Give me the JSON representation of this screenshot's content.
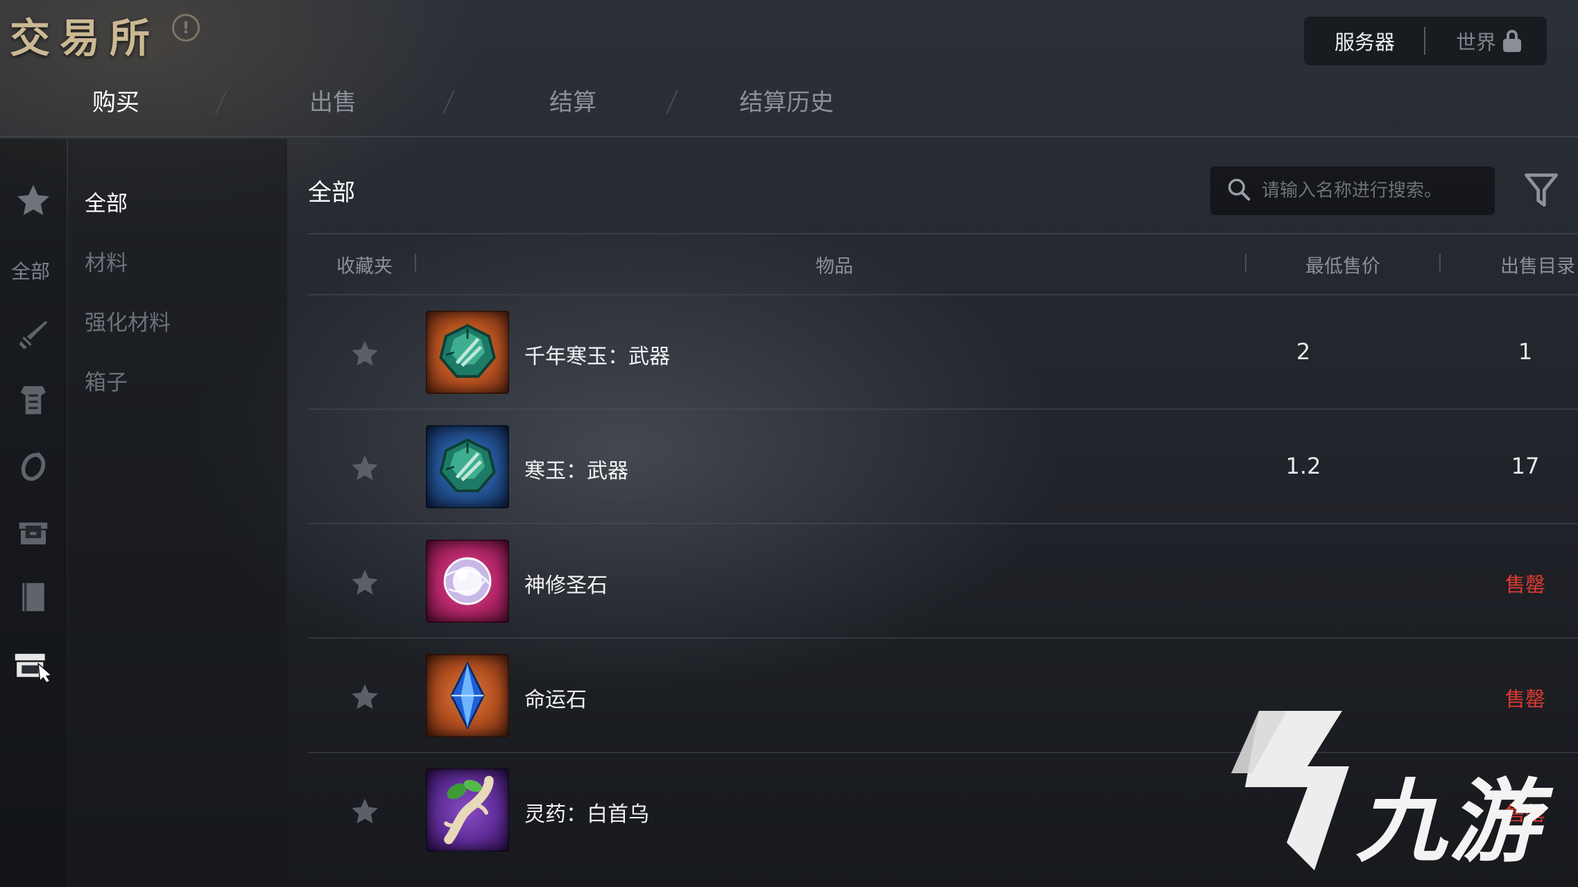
{
  "header": {
    "title": "交易所",
    "server_options": [
      {
        "label": "服务器",
        "active": true
      },
      {
        "label": "世界",
        "active": false,
        "locked": true
      }
    ],
    "tabs": [
      {
        "label": "购买",
        "active": true
      },
      {
        "label": "出售",
        "active": false
      },
      {
        "label": "结算",
        "active": false
      },
      {
        "label": "结算历史",
        "active": false
      }
    ]
  },
  "rail": {
    "items": [
      "star-icon",
      "all",
      "sword-icon",
      "armor-icon",
      "ring-icon",
      "chest-icon",
      "book-icon",
      "trade-icon"
    ],
    "all_label": "全部"
  },
  "categories": [
    {
      "label": "全部",
      "active": true
    },
    {
      "label": "材料",
      "active": false
    },
    {
      "label": "强化材料",
      "active": false
    },
    {
      "label": "箱子",
      "active": false
    }
  ],
  "main": {
    "heading": "全部",
    "search_placeholder": "请输入名称进行搜索。",
    "columns": {
      "favorite": "收藏夹",
      "item": "物品",
      "min_price": "最低售价",
      "listings": "出售目录"
    },
    "rows": [
      {
        "name": "千年寒玉：武器",
        "price": "2",
        "listings": "1",
        "icon": "jade-stone-icon",
        "frame": "orange"
      },
      {
        "name": "寒玉：武器",
        "price": "1.2",
        "listings": "17",
        "icon": "jade-stone-icon",
        "frame": "blue"
      },
      {
        "name": "神修圣石",
        "price": "",
        "listings": "售罄",
        "icon": "orb-icon",
        "frame": "pink"
      },
      {
        "name": "命运石",
        "price": "",
        "listings": "售罄",
        "icon": "crystal-icon",
        "frame": "orange"
      },
      {
        "name": "灵药：白首乌",
        "price": "",
        "listings": "售罄",
        "icon": "herb-root-icon",
        "frame": "purple"
      }
    ]
  },
  "watermark": {
    "text": "九游"
  },
  "colors": {
    "sold_out": "#e0392f",
    "title_gold": "#cbb993"
  }
}
